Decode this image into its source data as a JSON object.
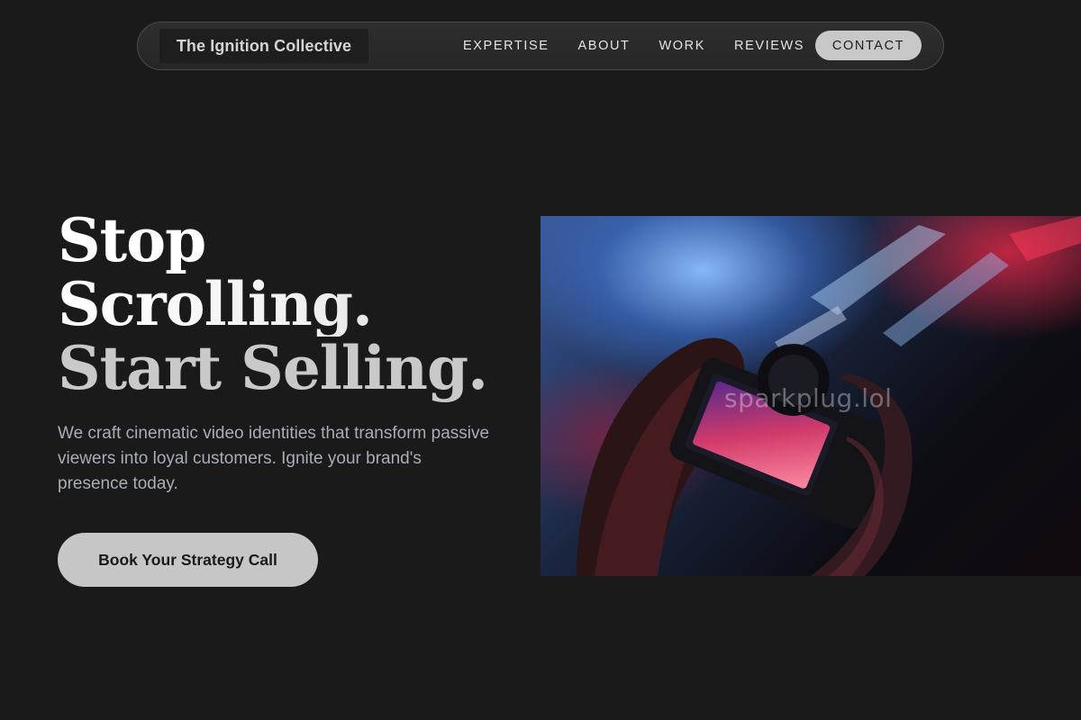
{
  "nav": {
    "brand": "The Ignition Collective",
    "links": [
      "EXPERTISE",
      "ABOUT",
      "WORK",
      "REVIEWS"
    ],
    "contact": "CONTACT"
  },
  "hero": {
    "headline_line1": "Stop",
    "headline_line2": "Scrolling.",
    "headline_line3": "Start Selling.",
    "subtext": "We craft cinematic video identities that transform passive viewers into loyal customers. Ignite your brand's presence today.",
    "cta": "Book Your Strategy Call",
    "image_watermark": "sparkplug.lol"
  },
  "colors": {
    "background": "#1a1a1a",
    "button_bg": "#c6c6c6",
    "subtext": "#a8adb8"
  }
}
